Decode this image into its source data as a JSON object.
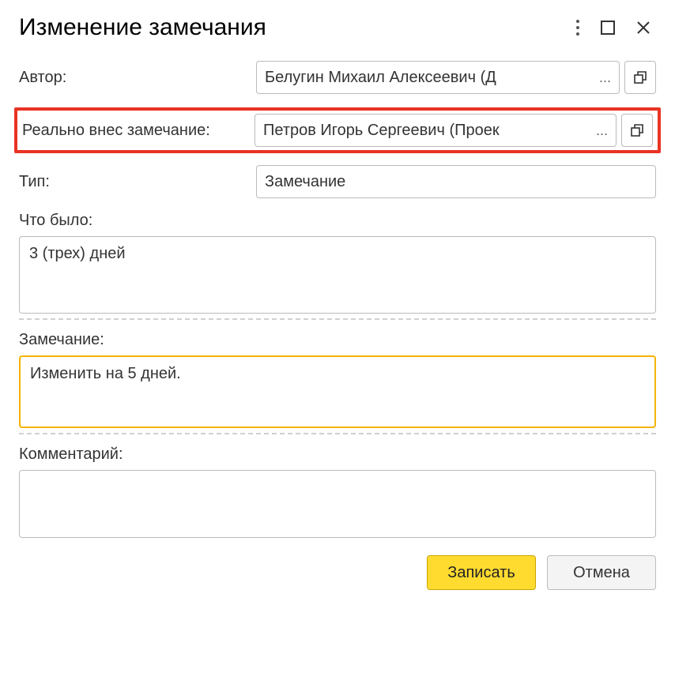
{
  "title": "Изменение замечания",
  "fields": {
    "author": {
      "label": "Автор:",
      "value": "Белугин Михаил Алексеевич (Д"
    },
    "real_author": {
      "label": "Реально внес замечание:",
      "value": "Петров Игорь Сергеевич (Проек"
    },
    "type": {
      "label": "Тип:",
      "value": "Замечание"
    },
    "what_was": {
      "label": "Что было:",
      "value": "3 (трех) дней"
    },
    "remark": {
      "label": "Замечание:",
      "value": "Изменить на 5 дней."
    },
    "comment": {
      "label": "Комментарий:",
      "value": ""
    }
  },
  "buttons": {
    "save": "Записать",
    "cancel": "Отмена",
    "ellipsis": "..."
  }
}
